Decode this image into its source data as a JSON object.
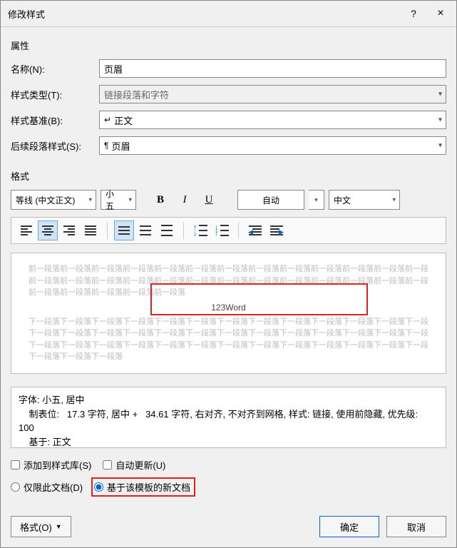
{
  "title": "修改样式",
  "help_symbol": "?",
  "close_symbol": "×",
  "properties": {
    "section": "属性",
    "name_label": "名称(N):",
    "name_value": "页眉",
    "type_label": "样式类型(T):",
    "type_value": "链接段落和字符",
    "base_label": "样式基准(B):",
    "base_value": "正文",
    "next_label": "后续段落样式(S):",
    "next_value": "页眉"
  },
  "format": {
    "section": "格式",
    "font_name": "等线 (中文正文)",
    "font_size": "小五",
    "auto_color": "自动",
    "language": "中文"
  },
  "preview": {
    "before_text": "前一段落前一段落前一段落前一段落前一段落前一段落前一段落前一段落前一段落前一段落前一段落前一段落前一段落前一段落前一段落前一段落前一段落前一段落前一段落前一段落前一段落前一段落前一段落前一段落",
    "sample": "123Word",
    "after_text": "下一段落下一段落下一段落下一段落下一段落下一段落下一段落下一段落下一段落下一段落下一段落下一段落下一段落下一段落下一段落下一段落下一段落下一段落下一段落下一段落下一段落下一段落下一段落下一段落下一段落下一段落下一段落下一段落下一段落下一段落下一段落下一段落下一段落下一段落下一段落"
  },
  "description": {
    "line1": "字体: 小五, 居中",
    "line2": "    制表位:   17.3 字符, 居中 +   34.61 字符, 右对齐, 不对齐到网格, 样式: 链接, 使用前隐藏, 优先级:",
    "line3": "100",
    "line4": "    基于: 正文"
  },
  "options": {
    "add_gallery": "添加到样式库(S)",
    "auto_update": "自动更新(U)",
    "only_doc": "仅限此文档(D)",
    "new_docs": "基于该模板的新文档"
  },
  "footer": {
    "format_btn": "格式(O)",
    "ok": "确定",
    "cancel": "取消"
  }
}
